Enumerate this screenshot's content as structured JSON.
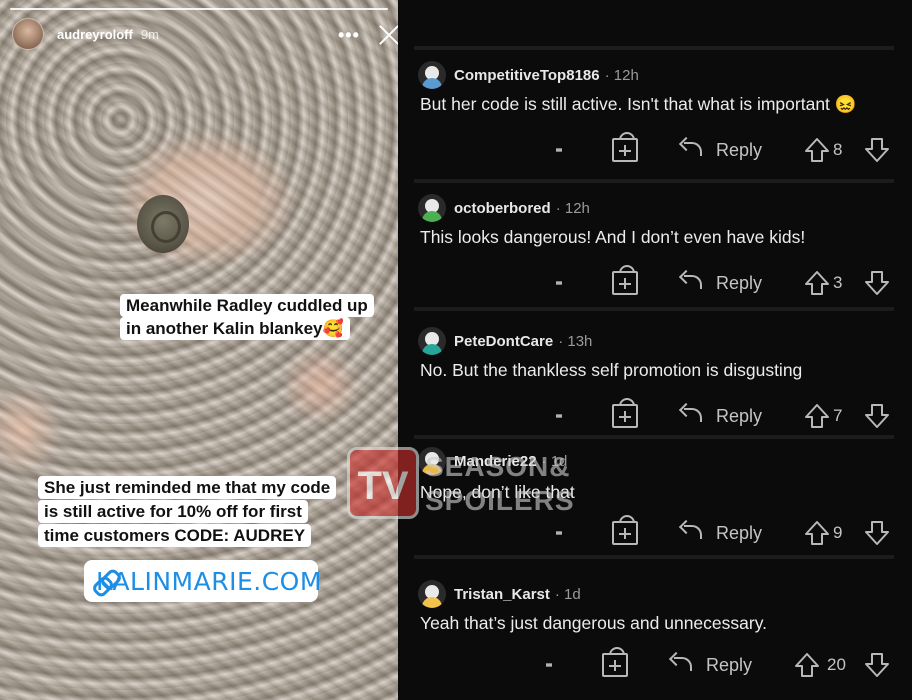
{
  "story": {
    "username": "audreyroloff",
    "time": "9m",
    "menu_glyph": "•••",
    "sticker1_lines": [
      "Meanwhile Radley cuddled up",
      "in another Kalin blankey🥰"
    ],
    "sticker2_lines": [
      "She just reminded me that my code",
      "is still active for 10% off for first",
      "time customers CODE: AUDREY"
    ],
    "link_text": "KALINMARIE.COM",
    "link_color": "#1d8ee6"
  },
  "comments": [
    {
      "user": "CompetitiveTop8186",
      "time": "· 12h",
      "text": "But her code is still active. Isn't that what is important 😖",
      "reply": "Reply",
      "votes": "8",
      "avatar_color": "#5a9bd4"
    },
    {
      "user": "octoberbored",
      "time": "· 12h",
      "text": "This looks dangerous! And I don’t even have kids!",
      "reply": "Reply",
      "votes": "3",
      "avatar_color": "#4caf50"
    },
    {
      "user": "PeteDontCare",
      "time": "· 13h",
      "text": "No. But the thankless self promotion is disgusting",
      "reply": "Reply",
      "votes": "7",
      "avatar_color": "#26a69a"
    },
    {
      "user": "Manderie22",
      "time": "· 1d",
      "text": "Nope, don’t like that",
      "reply": "Reply",
      "votes": "9",
      "avatar_color": "#e8b84a"
    },
    {
      "user": "Tristan_Karst",
      "time": "· 1d",
      "text": "Yeah that’s just dangerous and unnecessary.",
      "reply": "Reply",
      "votes": "20",
      "avatar_color": "#f2c14e"
    }
  ],
  "watermark": {
    "tv": "TV",
    "line1": "SEASON&",
    "line2": "SPOILERS"
  }
}
